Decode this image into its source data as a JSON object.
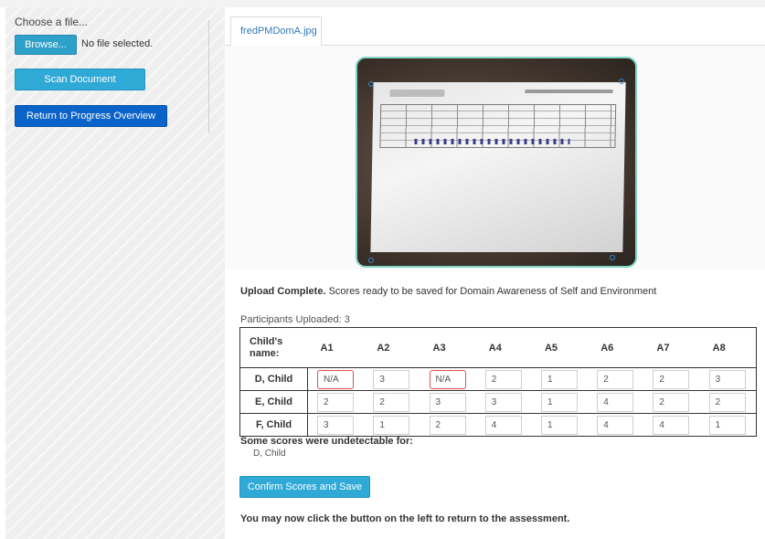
{
  "sidebar": {
    "choose_label": "Choose a file...",
    "browse_label": "Browse...",
    "file_status": "No file selected.",
    "scan_label": "Scan Document",
    "return_label": "Return to Progress Overview"
  },
  "main": {
    "tab_label": "fredPMDomA.jpg",
    "upload_bold": "Upload Complete.",
    "upload_text": " Scores ready to be saved for Domain Awareness of Self and Environment",
    "participants": "Participants Uploaded: 3",
    "table": {
      "name_header": "Child's name:",
      "columns": [
        "A1",
        "A2",
        "A3",
        "A4",
        "A5",
        "A6",
        "A7",
        "A8"
      ],
      "rows": [
        {
          "name": "D, Child",
          "scores": [
            "N/A",
            "3",
            "N/A",
            "2",
            "1",
            "2",
            "2",
            "3"
          ],
          "flagged": [
            true,
            false,
            true,
            false,
            false,
            false,
            false,
            false
          ]
        },
        {
          "name": "E, Child",
          "scores": [
            "2",
            "2",
            "3",
            "3",
            "1",
            "4",
            "2",
            "2"
          ],
          "flagged": [
            false,
            false,
            false,
            false,
            false,
            false,
            false,
            false
          ]
        },
        {
          "name": "F, Child",
          "scores": [
            "3",
            "1",
            "2",
            "4",
            "1",
            "4",
            "4",
            "1"
          ],
          "flagged": [
            false,
            false,
            false,
            false,
            false,
            false,
            false,
            false
          ]
        }
      ]
    },
    "undetectable_label": "Some scores were undetectable for:",
    "undetectable_names": "D, Child",
    "confirm_label": "Confirm Scores and Save",
    "final_message": "You may now click the button on the left to return to the assessment."
  },
  "colors": {
    "primary_button": "#2fa9d6",
    "return_button": "#0a63c9",
    "flag_border": "#d9534f",
    "tab_text": "#337ab7",
    "photo_frame": "#7fd4c3"
  }
}
